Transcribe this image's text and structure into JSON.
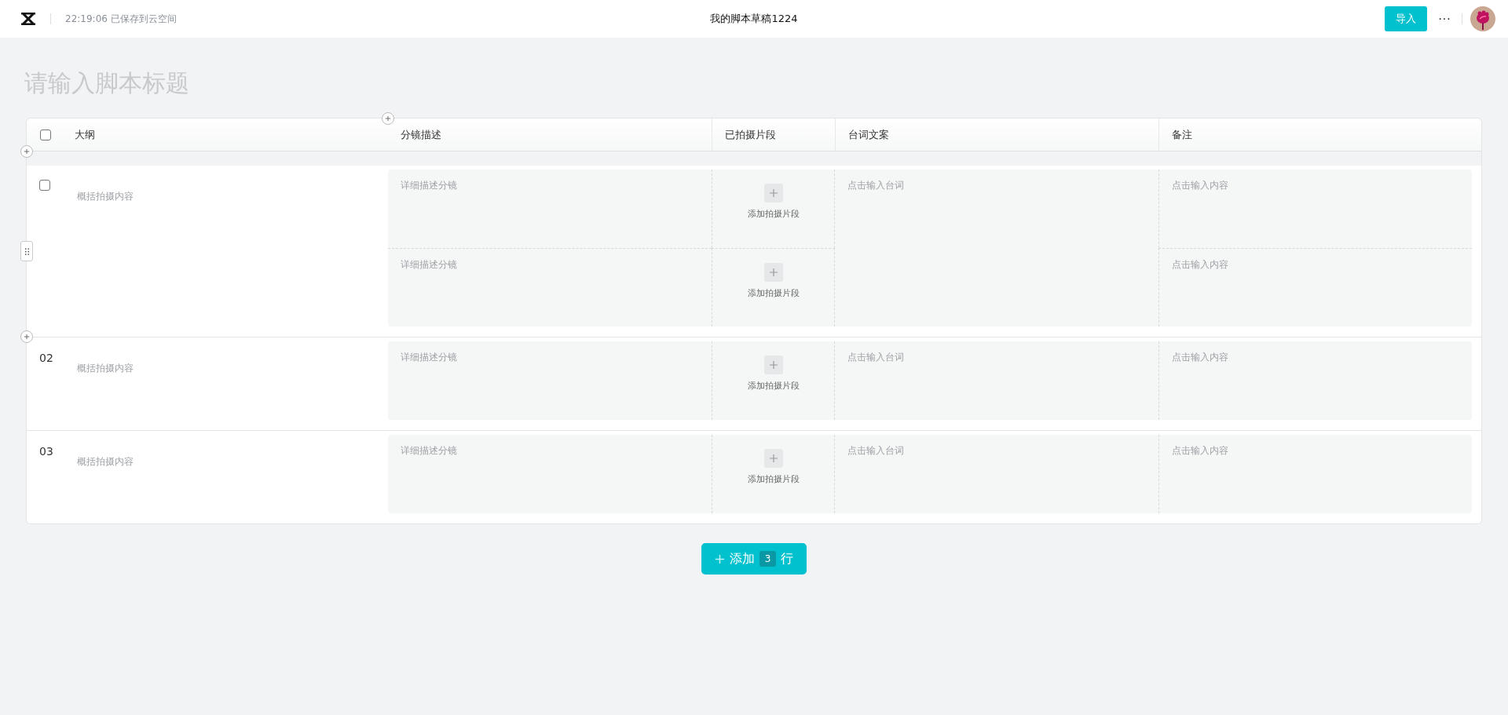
{
  "topbar": {
    "save_status": "22:19:06 已保存到云空间",
    "document_title": "我的脚本草稿1224",
    "import_button": "导入",
    "more_button": "···"
  },
  "script_title": {
    "placeholder": "请输入脚本标题"
  },
  "table": {
    "select_all": {
      "checked": false
    },
    "columns": [
      "大纲",
      "分镜描述",
      "已拍摄片段",
      "台词文案",
      "备注"
    ],
    "rows": [
      {
        "kind": "checkbox",
        "checked": false,
        "outline": {
          "placeholder": "概括拍摄内容"
        },
        "lines": {
          "placeholder": "点击输入台词"
        },
        "shots": [
          {
            "description": {
              "placeholder": "详细描述分镜"
            },
            "clip_button": "添加拍摄片段",
            "notes": {
              "placeholder": "点击输入内容"
            }
          },
          {
            "description": {
              "placeholder": "详细描述分镜"
            },
            "clip_button": "添加拍摄片段",
            "notes": {
              "placeholder": "点击输入内容"
            }
          }
        ]
      },
      {
        "kind": "number",
        "number": "02",
        "outline": {
          "placeholder": "概括拍摄内容"
        },
        "lines": {
          "placeholder": "点击输入台词"
        },
        "shots": [
          {
            "description": {
              "placeholder": "详细描述分镜"
            },
            "clip_button": "添加拍摄片段",
            "notes": {
              "placeholder": "点击输入内容"
            }
          }
        ]
      },
      {
        "kind": "number",
        "number": "03",
        "outline": {
          "placeholder": "概括拍摄内容"
        },
        "lines": {
          "placeholder": "点击输入台词"
        },
        "shots": [
          {
            "description": {
              "placeholder": "详细描述分镜"
            },
            "clip_button": "添加拍摄片段",
            "notes": {
              "placeholder": "点击输入内容"
            }
          }
        ]
      }
    ]
  },
  "add_rows_button": {
    "label": "添加",
    "count": "3",
    "unit": "行"
  }
}
